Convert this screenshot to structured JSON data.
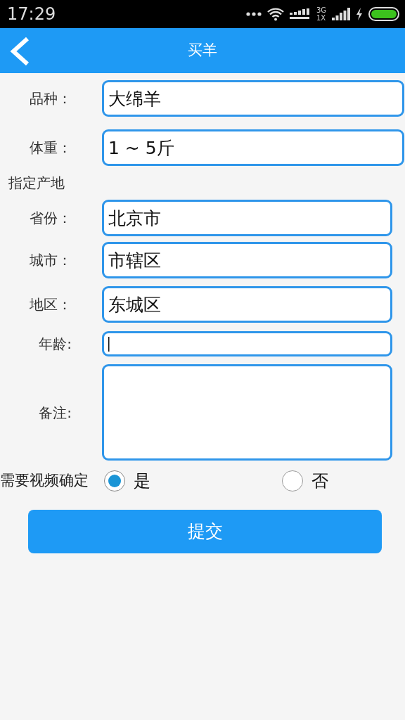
{
  "status_bar": {
    "time": "17:29",
    "network": "3G",
    "sim": "1X"
  },
  "header": {
    "title": "买羊"
  },
  "form": [
    {
      "kind": "field",
      "label": "品种：",
      "value": "大绵羊",
      "wide": true,
      "focused": false
    },
    {
      "kind": "field",
      "label": "体重：",
      "value": "1 ~ 5斤",
      "wide": true,
      "focused": false
    },
    {
      "kind": "heading",
      "label": "指定产地"
    },
    {
      "kind": "field",
      "label": "省份：",
      "value": "北京市",
      "wide": false,
      "focused": false
    },
    {
      "kind": "field",
      "label": "城市：",
      "value": "市辖区",
      "wide": false,
      "focused": false
    },
    {
      "kind": "field",
      "label": "地区：",
      "value": "东城区",
      "wide": false,
      "focused": false
    },
    {
      "kind": "small",
      "label": "年龄:",
      "wide": false,
      "focused": true
    },
    {
      "kind": "textarea",
      "label": "备注:",
      "wide": false,
      "focused": false
    }
  ],
  "video_confirm": {
    "label": "需要视频确定",
    "options": [
      {
        "label": "是",
        "selected": true
      },
      {
        "label": "否",
        "selected": false
      }
    ]
  },
  "submit": {
    "label": "提交"
  }
}
